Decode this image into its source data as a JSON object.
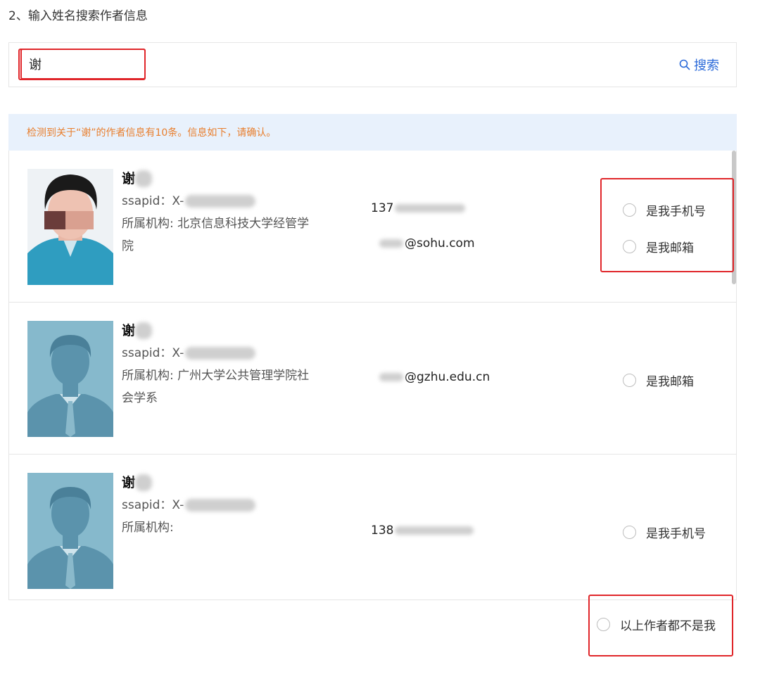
{
  "step_title": "2、输入姓名搜索作者信息",
  "search": {
    "value": "谢",
    "button_label": "搜索"
  },
  "notice": "检测到关于“谢”的作者信息有10条。信息如下，请确认。",
  "authors": [
    {
      "name": "谢",
      "ssapid": "ssapid：X-",
      "org_label": "所属机构:",
      "org_line1": "北京信息科技大学经管学",
      "org_line2": "院",
      "phone": "137",
      "email": "@sohu.com",
      "options": [
        "是我手机号",
        "是我邮箱"
      ]
    },
    {
      "name": "谢",
      "ssapid": "ssapid：X-",
      "org_label": "所属机构:",
      "org_line1": "广州大学公共管理学院社",
      "org_line2": "会学系",
      "phone": "",
      "email": "@gzhu.edu.cn",
      "options": [
        "是我邮箱"
      ]
    },
    {
      "name": "谢",
      "ssapid": "ssapid：X-",
      "org_label": "所属机构:",
      "org_line1": "",
      "org_line2": "",
      "phone": "138",
      "email": "",
      "options": [
        "是我手机号"
      ]
    }
  ],
  "none_option": "以上作者都不是我",
  "colors": {
    "highlight": "#e0262a",
    "link": "#2b6ad9",
    "notice_text": "#e87e2d",
    "notice_bg": "#e8f1fc"
  }
}
